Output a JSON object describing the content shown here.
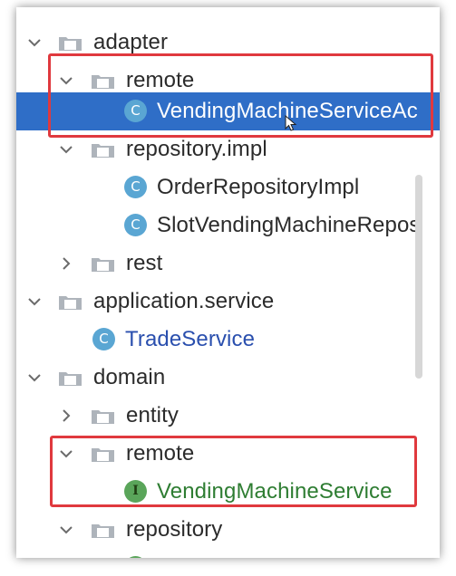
{
  "tree": {
    "items": [
      {
        "label": "adapter",
        "type": "folder",
        "expanded": true
      },
      {
        "label": "remote",
        "type": "folder",
        "expanded": true
      },
      {
        "label": "VendingMachineServiceAc",
        "type": "class",
        "selected": true
      },
      {
        "label": "repository.impl",
        "type": "folder",
        "expanded": true
      },
      {
        "label": "OrderRepositoryImpl",
        "type": "class"
      },
      {
        "label": "SlotVendingMachineRepos",
        "type": "class"
      },
      {
        "label": "rest",
        "type": "folder",
        "expanded": false
      },
      {
        "label": "application.service",
        "type": "folder",
        "expanded": true
      },
      {
        "label": "TradeService",
        "type": "class"
      },
      {
        "label": "domain",
        "type": "folder",
        "expanded": true
      },
      {
        "label": "entity",
        "type": "folder",
        "expanded": false
      },
      {
        "label": "remote",
        "type": "folder",
        "expanded": true
      },
      {
        "label": "VendingMachineService",
        "type": "interface"
      },
      {
        "label": "repository",
        "type": "folder",
        "expanded": true
      }
    ]
  },
  "icons": {
    "class_glyph": "C",
    "interface_glyph": "I"
  },
  "colors": {
    "selection": "#2f6ec7",
    "highlight_box": "#e0393e",
    "class_icon": "#5aa6d3",
    "interface_icon": "#5aa55a"
  }
}
